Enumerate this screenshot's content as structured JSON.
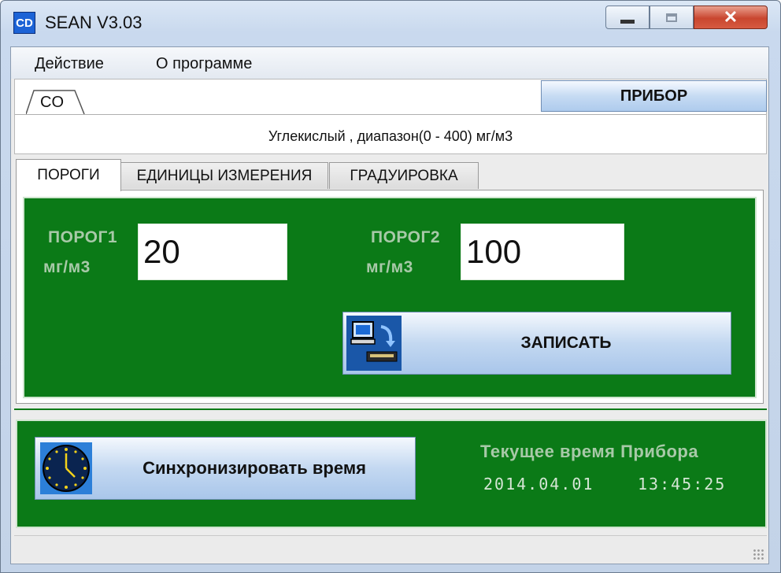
{
  "window": {
    "title": "SEAN V3.03",
    "app_icon_text": "CD",
    "controls": {
      "minimize_icon": "minimize-icon",
      "maximize_icon": "maximize-icon",
      "close_glyph": "✕"
    }
  },
  "menu": {
    "items": [
      "Действие",
      "О программе"
    ]
  },
  "gas_tab": {
    "label": "CO"
  },
  "device_button": {
    "label": "ПРИБОР"
  },
  "range_text": "Углекислый , диапазон(0 - 400) мг/м3",
  "tabs": [
    {
      "label": "ПОРОГИ",
      "active": true
    },
    {
      "label": "ЕДИНИЦЫ ИЗМЕРЕНИЯ",
      "active": false
    },
    {
      "label": "ГРАДУИРОВКА",
      "active": false
    }
  ],
  "thresholds": {
    "t1": {
      "label": "ПОРОГ1",
      "unit": "мг/м3",
      "value": "20"
    },
    "t2": {
      "label": "ПОРОГ2",
      "unit": "мг/м3",
      "value": "100"
    }
  },
  "write_button": {
    "label": "ЗАПИСАТЬ",
    "icon": "computer-transfer-icon"
  },
  "sync_button": {
    "label": "Синхронизировать время",
    "icon": "clock-icon"
  },
  "device_time": {
    "title": "Текущее время Прибора",
    "date": "2014.04.01",
    "time": "13:45:25"
  },
  "colors": {
    "panel_green": "#0b7a17",
    "label_green": "#a8c9a8",
    "button_blue": "#c3d8f1",
    "close_red": "#c9462f"
  }
}
